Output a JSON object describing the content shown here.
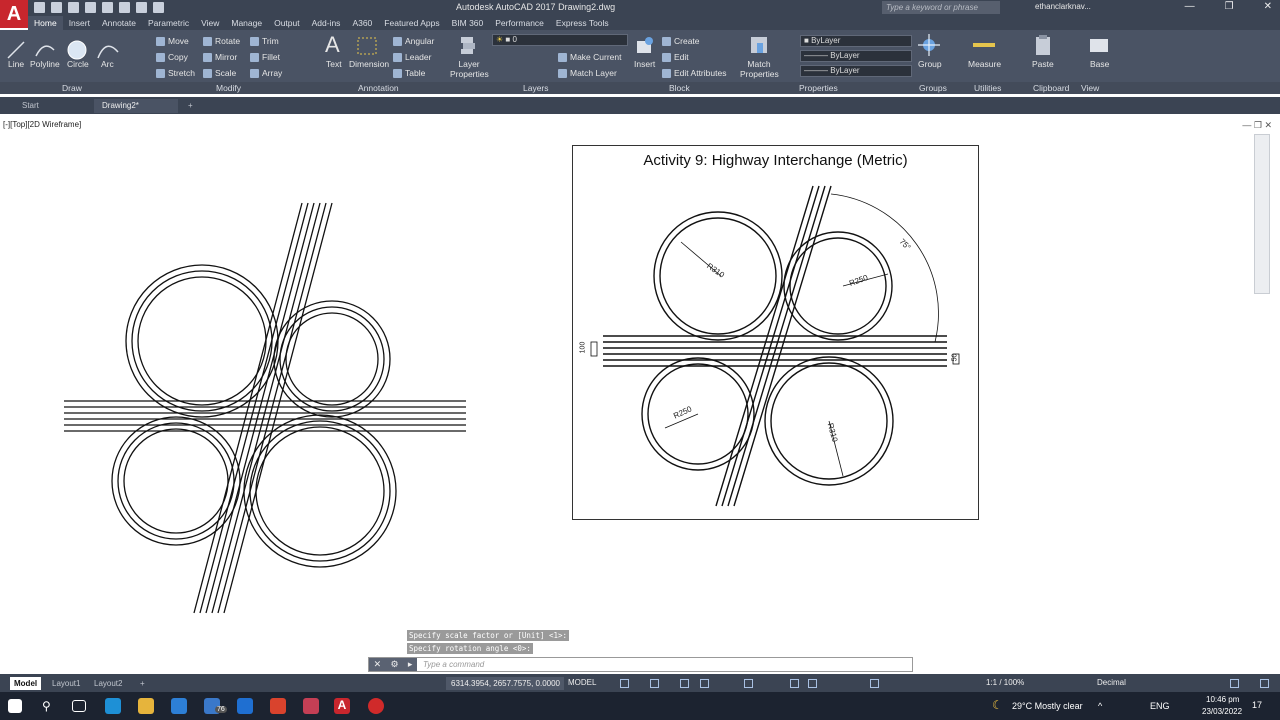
{
  "app": {
    "title": "Autodesk AutoCAD 2017    Drawing2.dwg",
    "logo_letter": "A",
    "search_placeholder": "Type a keyword or phrase",
    "user": "ethanclarknav...",
    "accent_color": "#c8262d"
  },
  "ribbon_tabs": [
    "Home",
    "Insert",
    "Annotate",
    "Parametric",
    "View",
    "Manage",
    "Output",
    "Add-ins",
    "A360",
    "Featured Apps",
    "BIM 360",
    "Performance",
    "Express Tools"
  ],
  "ribbon": {
    "draw": [
      "Line",
      "Polyline",
      "Circle",
      "Arc"
    ],
    "modify": [
      "Move",
      "Rotate",
      "Trim",
      "Copy",
      "Mirror",
      "Fillet",
      "Stretch",
      "Scale",
      "Array"
    ],
    "annotation": [
      "Text",
      "Dimension",
      "Angular",
      "Leader",
      "Table"
    ],
    "layers": {
      "properties": "Layer Properties",
      "current_layer": "0",
      "make_current": "Make Current",
      "match_layer": "Match Layer"
    },
    "block": [
      "Insert",
      "Create",
      "Edit",
      "Edit Attributes"
    ],
    "properties": {
      "match": "Match Properties",
      "color": "ByLayer",
      "linetype": "ByLayer",
      "lineweight": "ByLayer"
    },
    "groups": "Group",
    "utilities": "Measure",
    "clipboard": "Paste",
    "view": "Base"
  },
  "panel_labels": [
    "Draw",
    "Modify",
    "Annotation",
    "Layers",
    "Block",
    "Properties",
    "Groups",
    "Utilities",
    "Clipboard",
    "View"
  ],
  "doc_tabs": [
    "Start",
    "Drawing2*"
  ],
  "viewport_label": "[-][Top][2D Wireframe]",
  "reference": {
    "title": "Activity 9: Highway Interchange  (Metric)",
    "dims": [
      "R310",
      "R250",
      "R250",
      "R310",
      "75°",
      "100",
      "50"
    ]
  },
  "command": {
    "history": [
      "Specify scale factor or [Unit] <1>:",
      "Specify rotation angle <0>:"
    ],
    "placeholder": "Type a command"
  },
  "layout_tabs": [
    "Model",
    "Layout1",
    "Layout2"
  ],
  "status": {
    "coords": "6314.3954, 2657.7575, 0.0000",
    "mode": "MODEL",
    "scale": "1:1 / 100%",
    "units": "Decimal"
  },
  "taskbar": {
    "weather": "29°C  Mostly clear",
    "lang": "ENG",
    "time": "10:46 pm",
    "date": "23/03/2022",
    "badge_mail": "76",
    "notifications": "17"
  }
}
